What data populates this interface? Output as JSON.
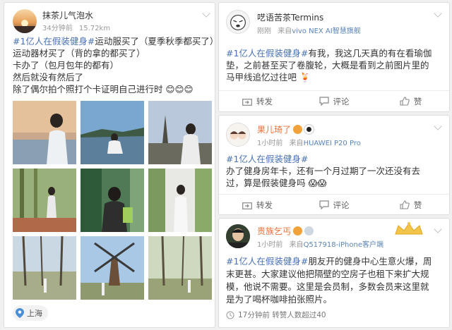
{
  "left_post": {
    "author": "抹茶儿气泡水",
    "time": "34分钟前",
    "size": "15.72km",
    "tag": "#1亿人在假装健身#",
    "lines": [
      "运动服买了（夏季秋季都买了）",
      "运动器材买了（背的拿的都买了）",
      "卡办了（包月包年的都有）",
      "然后就没有然后了",
      "除了偶尔拍个照打个卡证明自己进行时"
    ],
    "location": "上海",
    "photo_count": 9
  },
  "right_posts": [
    {
      "author": "呓语苦茶Termins",
      "time": "刚刚",
      "source_prefix": "来自",
      "device": "vivo NEX AI智慧旗舰",
      "tag": "#1亿人在假装健身#",
      "lines": [
        "有我，我这几天真的有在看瑜伽",
        "垫，之前甚至买了卷腹轮，大概是看到之前图片里的",
        "马甲线追忆过往吧"
      ],
      "actions": [
        "转发",
        "评论",
        "赞"
      ]
    },
    {
      "author": "果儿琦了",
      "time": "1小时前",
      "source_prefix": "来自",
      "device": "HUAWEI P20 Pro",
      "tag": "#1亿人在假装健身#",
      "lines": [
        "办了健身房年卡，还有一个月过期了一次还没有去",
        "过，算是假装健身吗"
      ],
      "actions": [
        "转发",
        "评论",
        "赞"
      ]
    },
    {
      "author": "贵族乞丐",
      "time": "1小时前",
      "source_prefix": "来自",
      "device": "Q517918-iPhone客户端",
      "tag": "#1亿人在假装健身#",
      "lines": [
        "朋友开的健身中心生意火爆，周",
        "末更甚。大家建议他把隔壁的空房子也租下来扩大规",
        "模，他说不需要。这里是会员制，多数会员来这里就",
        "是为了喝杯咖啡拍张照片。"
      ],
      "footer": "17分钟前 转赞人数超过40"
    }
  ],
  "colors": {
    "tag": "#4a72b4",
    "meta": "#999999",
    "accent_orange": "#e8733a"
  }
}
